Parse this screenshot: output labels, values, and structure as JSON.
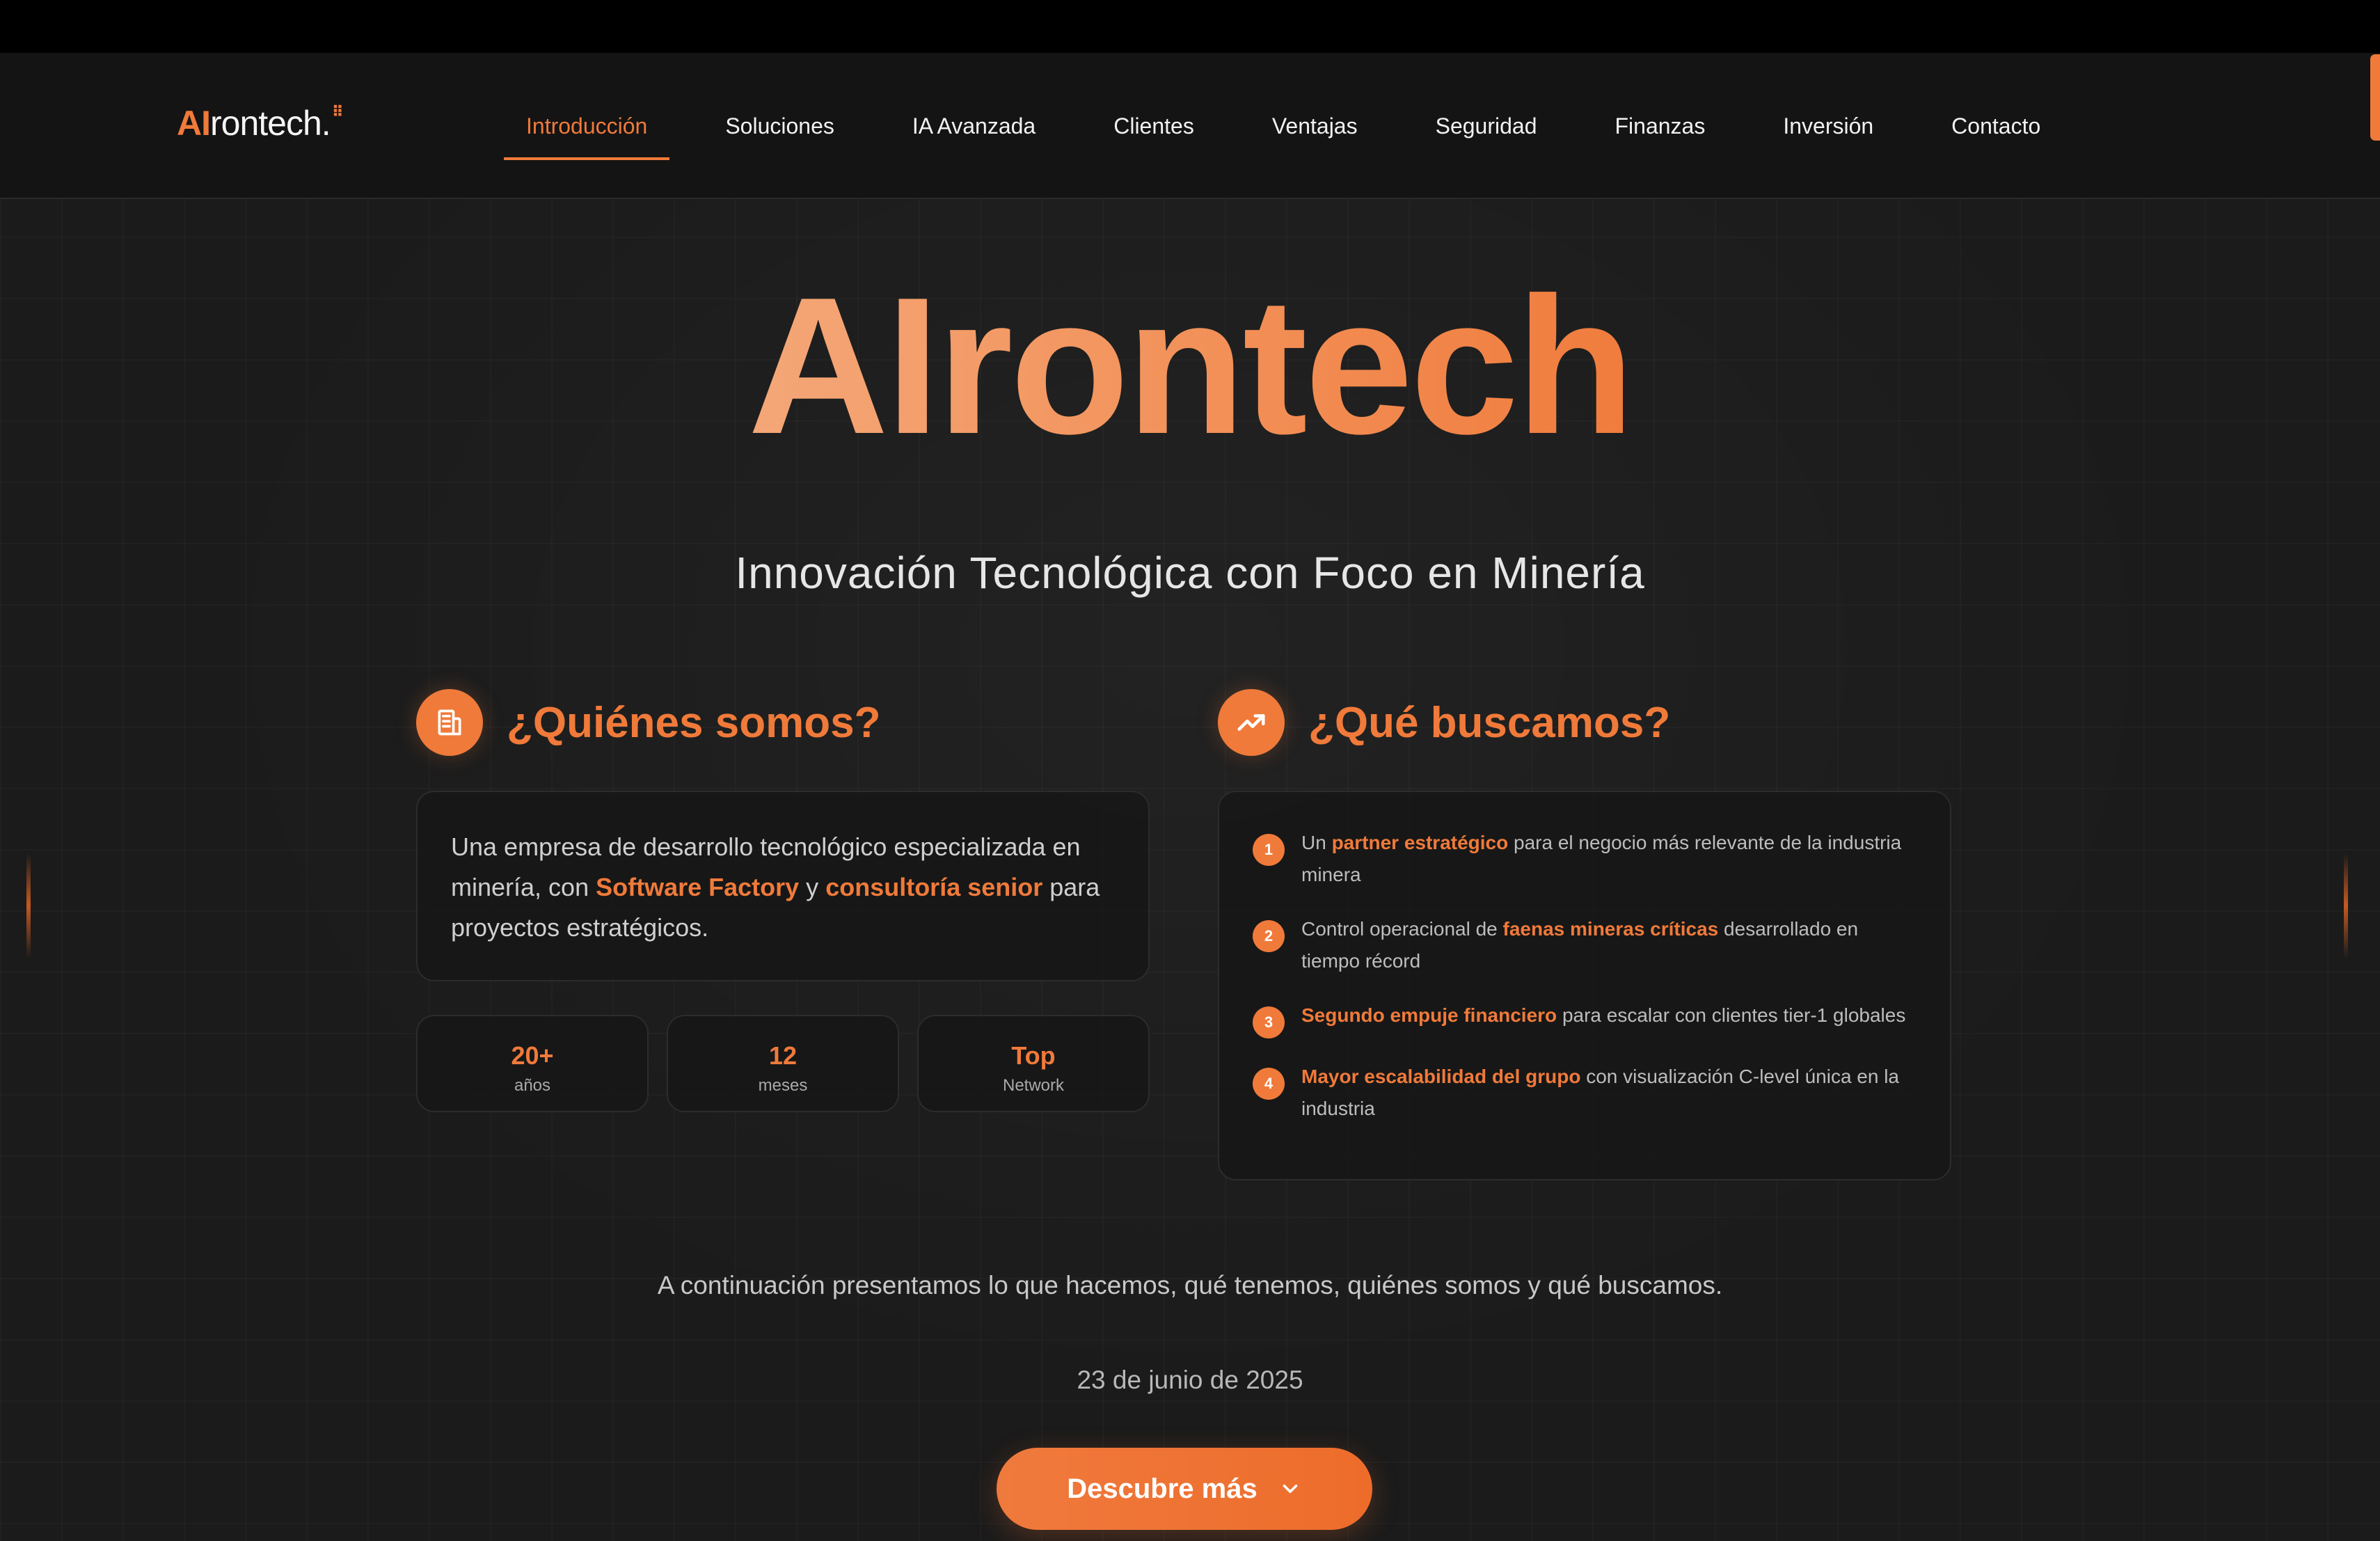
{
  "brand": {
    "logo_ai": "AI",
    "logo_rest": "rontech.",
    "accent": "#f07a3a"
  },
  "nav": {
    "items": [
      {
        "label": "Introducción",
        "active": true
      },
      {
        "label": "Soluciones"
      },
      {
        "label": "IA Avanzada"
      },
      {
        "label": "Clientes"
      },
      {
        "label": "Ventajas"
      },
      {
        "label": "Seguridad"
      },
      {
        "label": "Finanzas"
      },
      {
        "label": "Inversión"
      },
      {
        "label": "Contacto"
      }
    ]
  },
  "hero": {
    "title": "AIrontech",
    "subtitle": "Innovación Tecnológica con Foco en Minería"
  },
  "who": {
    "heading": "¿Quiénes somos?",
    "icon": "building-icon",
    "text_1": "Una empresa de desarrollo tecnológico especializada en minería, con ",
    "hl_1": "Software Factory",
    "text_2": " y ",
    "hl_2": "consultoría senior",
    "text_3": " para proyectos estratégicos.",
    "stats": [
      {
        "value": "20+",
        "label": "años"
      },
      {
        "value": "12",
        "label": "meses"
      },
      {
        "value": "Top",
        "label": "Network"
      }
    ]
  },
  "seek": {
    "heading": "¿Qué buscamos?",
    "icon": "trending-up-icon",
    "items": [
      {
        "num": "1",
        "pre": "Un ",
        "hl": "partner estratégico",
        "post": " para el negocio más relevante de la industria minera"
      },
      {
        "num": "2",
        "pre": "Control operacional de ",
        "hl": "faenas mineras críticas",
        "post": " desarrollado en tiempo récord"
      },
      {
        "num": "3",
        "pre": "",
        "hl": "Segundo empuje financiero",
        "post": " para escalar con clientes tier-1 globales"
      },
      {
        "num": "4",
        "pre": "",
        "hl": "Mayor escalabilidad del grupo",
        "post": " con visualización C-level única en la industria"
      }
    ]
  },
  "intro_line": "A continuación presentamos lo que hacemos, qué tenemos, quiénes somos y qué buscamos.",
  "date": "23 de junio de 2025",
  "cta": {
    "label": "Descubre más",
    "icon": "chevron-down-icon"
  }
}
